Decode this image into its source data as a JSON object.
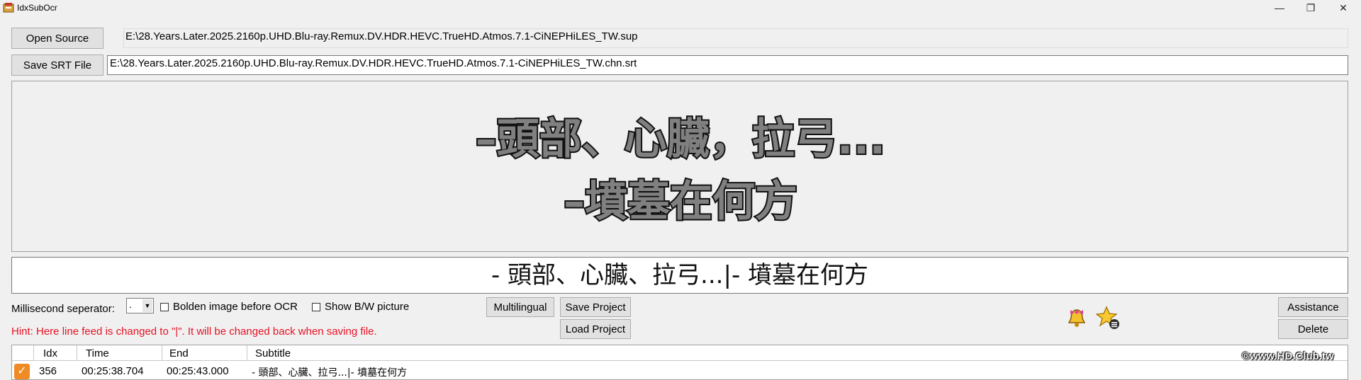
{
  "window": {
    "title": "IdxSubOcr",
    "minimize": "—",
    "maximize": "❐",
    "close": "✕"
  },
  "source": {
    "open_label": "Open Source",
    "path": "E:\\28.Years.Later.2025.2160p.UHD.Blu-ray.Remux.DV.HDR.HEVC.TrueHD.Atmos.7.1-CiNEPHiLES_TW.sup"
  },
  "output": {
    "save_label": "Save SRT File",
    "path": "E:\\28.Years.Later.2025.2160p.UHD.Blu-ray.Remux.DV.HDR.HEVC.TrueHD.Atmos.7.1-CiNEPHiLES_TW.chn.srt"
  },
  "preview": {
    "line1": "–頭部、心臟，拉弓...",
    "line2": "–墳墓在何方"
  },
  "ocr_text": "- 頭部、心臟、拉弓...|- 墳墓在何方",
  "options": {
    "ms_separator_label": "Millisecond seperator:",
    "ms_separator_value": ".",
    "bolden_label": "Bolden image before OCR",
    "bw_label": "Show B/W picture",
    "bolden_checked": false,
    "bw_checked": false
  },
  "buttons": {
    "multilingual": "Multilingual",
    "save_project": "Save Project",
    "load_project": "Load Project",
    "assistance": "Assistance",
    "delete": "Delete"
  },
  "hint": "Hint: Here line feed is changed to \"|\". It will be changed back when saving file.",
  "table": {
    "headers": [
      "Idx",
      "Time",
      "End",
      "Subtitle"
    ],
    "rows": [
      {
        "checked": true,
        "idx": "356",
        "time": "00:25:38.704",
        "end": "00:25:43.000",
        "subtitle": "- 頭部、心臟、拉弓...|- 墳墓在何方"
      }
    ]
  },
  "watermark": "©www.HD.Club.tw",
  "icons": {
    "app": "app-icon",
    "bell": "bell-icon",
    "star": "star-list-icon"
  }
}
